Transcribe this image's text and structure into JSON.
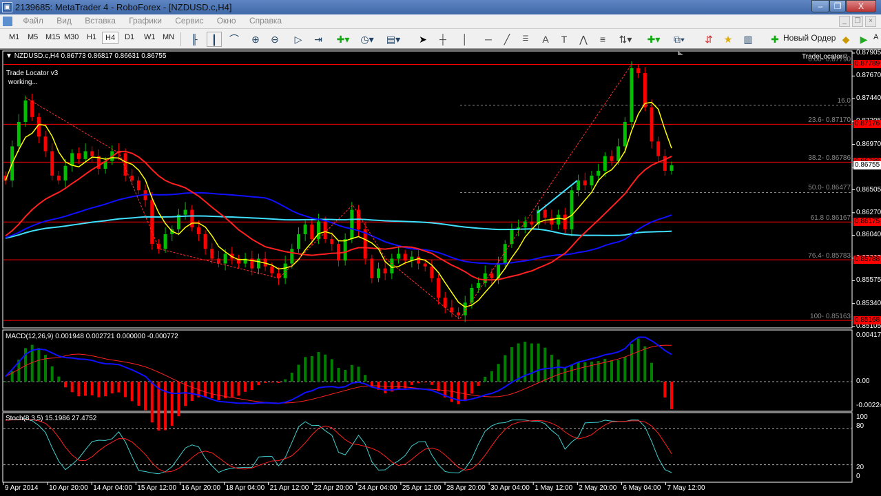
{
  "window": {
    "title": "2139685: MetaTrader 4 - RoboForex - [NZDUSD.c,H4]",
    "min": "–",
    "restore": "❐",
    "close": "X"
  },
  "menu": [
    "Файл",
    "Вид",
    "Вставка",
    "Графики",
    "Сервис",
    "Окно",
    "Справка"
  ],
  "toolbar": {
    "timeframes": [
      "M1",
      "M5",
      "M15",
      "M30",
      "H1",
      "H4",
      "D1",
      "W1",
      "MN"
    ],
    "active_tf": "H4",
    "new_order": "Новый Ордер",
    "autotrading": "A"
  },
  "chart": {
    "header": "NZDUSD.c,H4  0.86773 0.86817 0.86631 0.86755",
    "indicator_name": "Trade Locator v3",
    "indicator_status": "working...",
    "tradelocator_label": "TradeLocator",
    "price_ticks": [
      "0.87905",
      "0.87670",
      "0.87440",
      "0.87205",
      "0.86970",
      "0.86735",
      "0.86505",
      "0.86270",
      "0.86040",
      "0.85805",
      "0.85575",
      "0.85340",
      "0.85105"
    ],
    "level_labels": [
      {
        "price": 0.87789,
        "text": "0.87789"
      },
      {
        "price": 0.87176,
        "text": "0.87176"
      },
      {
        "price": 0.86788,
        "text": "0.86788"
      },
      {
        "price": 0.86175,
        "text": "0.86175"
      },
      {
        "price": 0.85788,
        "text": "0.85788"
      },
      {
        "price": 0.85168,
        "text": "0.85168"
      }
    ],
    "current_price": "0.86755",
    "fib_labels": [
      {
        "price": 0.8779,
        "text": "0.00- 0.87790"
      },
      {
        "price": 0.8737,
        "text": "16.0"
      },
      {
        "price": 0.8717,
        "text": "23.6- 0.87170"
      },
      {
        "price": 0.86786,
        "text": "38.2- 0.86786"
      },
      {
        "price": 0.86477,
        "text": "50.0- 0.86477"
      },
      {
        "price": 0.86167,
        "text": "61.8 0.86167"
      },
      {
        "price": 0.85783,
        "text": "76.4- 0.85783"
      },
      {
        "price": 0.85163,
        "text": "100- 0.85163"
      }
    ],
    "colors": {
      "bull": "#00c000",
      "bear": "#ff0000",
      "ma_fast": "#ffff00",
      "ma_mid": "#ff2020",
      "ma_slow": "#1010ff",
      "ma_long": "#40e0ff",
      "level": "#ff0000"
    }
  },
  "macd": {
    "header": "MACD(12,26,9) 0.001948 0.002721 0.000000 -0.000772",
    "ticks": [
      "0.004175",
      "0.00",
      "-0.002249"
    ]
  },
  "stoch": {
    "header": "Stoch(8,3,5) 15.1986 27.4752",
    "ticks": [
      "100",
      "80",
      "20",
      "0"
    ]
  },
  "time_axis": [
    "9 Apr 2014",
    "10 Apr 20:00",
    "14 Apr 04:00",
    "15 Apr 12:00",
    "16 Apr 20:00",
    "18 Apr 04:00",
    "21 Apr 12:00",
    "22 Apr 20:00",
    "24 Apr 04:00",
    "25 Apr 12:00",
    "28 Apr 20:00",
    "30 Apr 04:00",
    "1 May 12:00",
    "2 May 20:00",
    "6 May 04:00",
    "7 May 12:00"
  ],
  "chart_data": {
    "type": "candlestick",
    "symbol": "NZDUSD.c",
    "timeframe": "H4",
    "ylim": [
      0.85105,
      0.87905
    ],
    "closes": [
      0.866,
      0.8695,
      0.872,
      0.8742,
      0.8725,
      0.8705,
      0.869,
      0.8665,
      0.866,
      0.8675,
      0.8688,
      0.8682,
      0.869,
      0.8685,
      0.8672,
      0.868,
      0.869,
      0.8688,
      0.8665,
      0.866,
      0.865,
      0.864,
      0.8595,
      0.859,
      0.8605,
      0.861,
      0.8625,
      0.863,
      0.8612,
      0.8605,
      0.859,
      0.858,
      0.8575,
      0.8585,
      0.858,
      0.8575,
      0.858,
      0.857,
      0.858,
      0.8572,
      0.8565,
      0.856,
      0.8575,
      0.859,
      0.8605,
      0.8615,
      0.86,
      0.8618,
      0.86,
      0.8595,
      0.8578,
      0.86,
      0.863,
      0.861,
      0.858,
      0.856,
      0.857,
      0.8565,
      0.858,
      0.8585,
      0.8578,
      0.8582,
      0.8575,
      0.8572,
      0.856,
      0.854,
      0.853,
      0.8525,
      0.8522,
      0.8535,
      0.855,
      0.8555,
      0.8565,
      0.856,
      0.8575,
      0.8595,
      0.861,
      0.8612,
      0.8618,
      0.8615,
      0.863,
      0.8622,
      0.8615,
      0.8625,
      0.861,
      0.865,
      0.866,
      0.8655,
      0.8665,
      0.867,
      0.8685,
      0.868,
      0.8695,
      0.872,
      0.8775,
      0.877,
      0.8735,
      0.87,
      0.8685,
      0.867,
      0.86755
    ]
  }
}
